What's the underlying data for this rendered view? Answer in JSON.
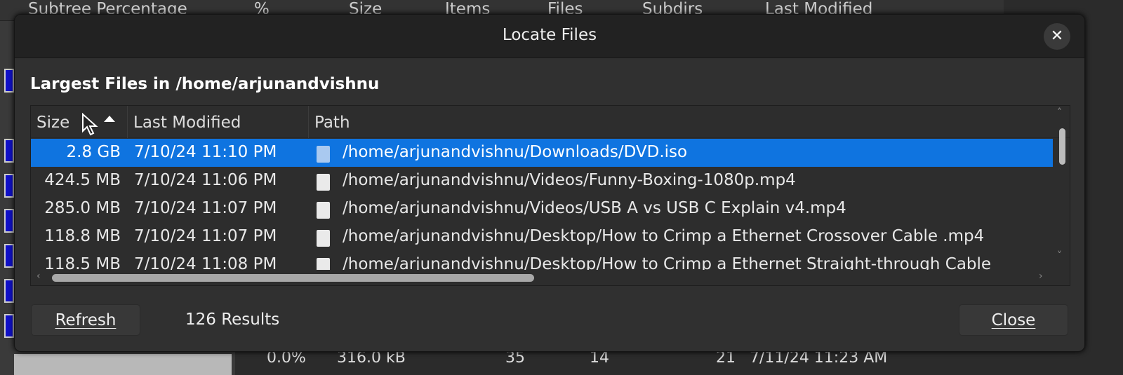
{
  "background": {
    "header": [
      "Subtree Percentage",
      "%",
      "Size",
      "Items",
      "Files",
      "Subdirs",
      "Last Modified"
    ],
    "row": {
      "percent": "0.0%",
      "size": "316.0 kB",
      "items": "35",
      "files": "14",
      "subdirs": "21",
      "modified": "7/11/24 11:23 AM"
    }
  },
  "dialog": {
    "title": "Locate Files",
    "heading": "Largest Files in /home/arjunandvishnu",
    "columns": [
      "Size",
      "Last Modified",
      "Path"
    ],
    "rows": [
      {
        "size": "2.8 GB",
        "modified": "7/10/24 11:10 PM",
        "path": "/home/arjunandvishnu/Downloads/DVD.iso"
      },
      {
        "size": "424.5 MB",
        "modified": "7/10/24 11:06 PM",
        "path": "/home/arjunandvishnu/Videos/Funny-Boxing-1080p.mp4"
      },
      {
        "size": "285.0 MB",
        "modified": "7/10/24 11:07 PM",
        "path": "/home/arjunandvishnu/Videos/USB A vs USB C Explain v4.mp4"
      },
      {
        "size": "118.8 MB",
        "modified": "7/10/24 11:07 PM",
        "path": "/home/arjunandvishnu/Desktop/How to Crimp a Ethernet Crossover Cable .mp4"
      },
      {
        "size": "118.5 MB",
        "modified": "7/10/24 11:08 PM",
        "path": "/home/arjunandvishnu/Desktop/How to Crimp a Ethernet Straight-through Cable"
      }
    ],
    "refresh_label": "Refresh",
    "results": "126 Results",
    "close_label": "Close",
    "selection_color": "#0f74e0"
  }
}
